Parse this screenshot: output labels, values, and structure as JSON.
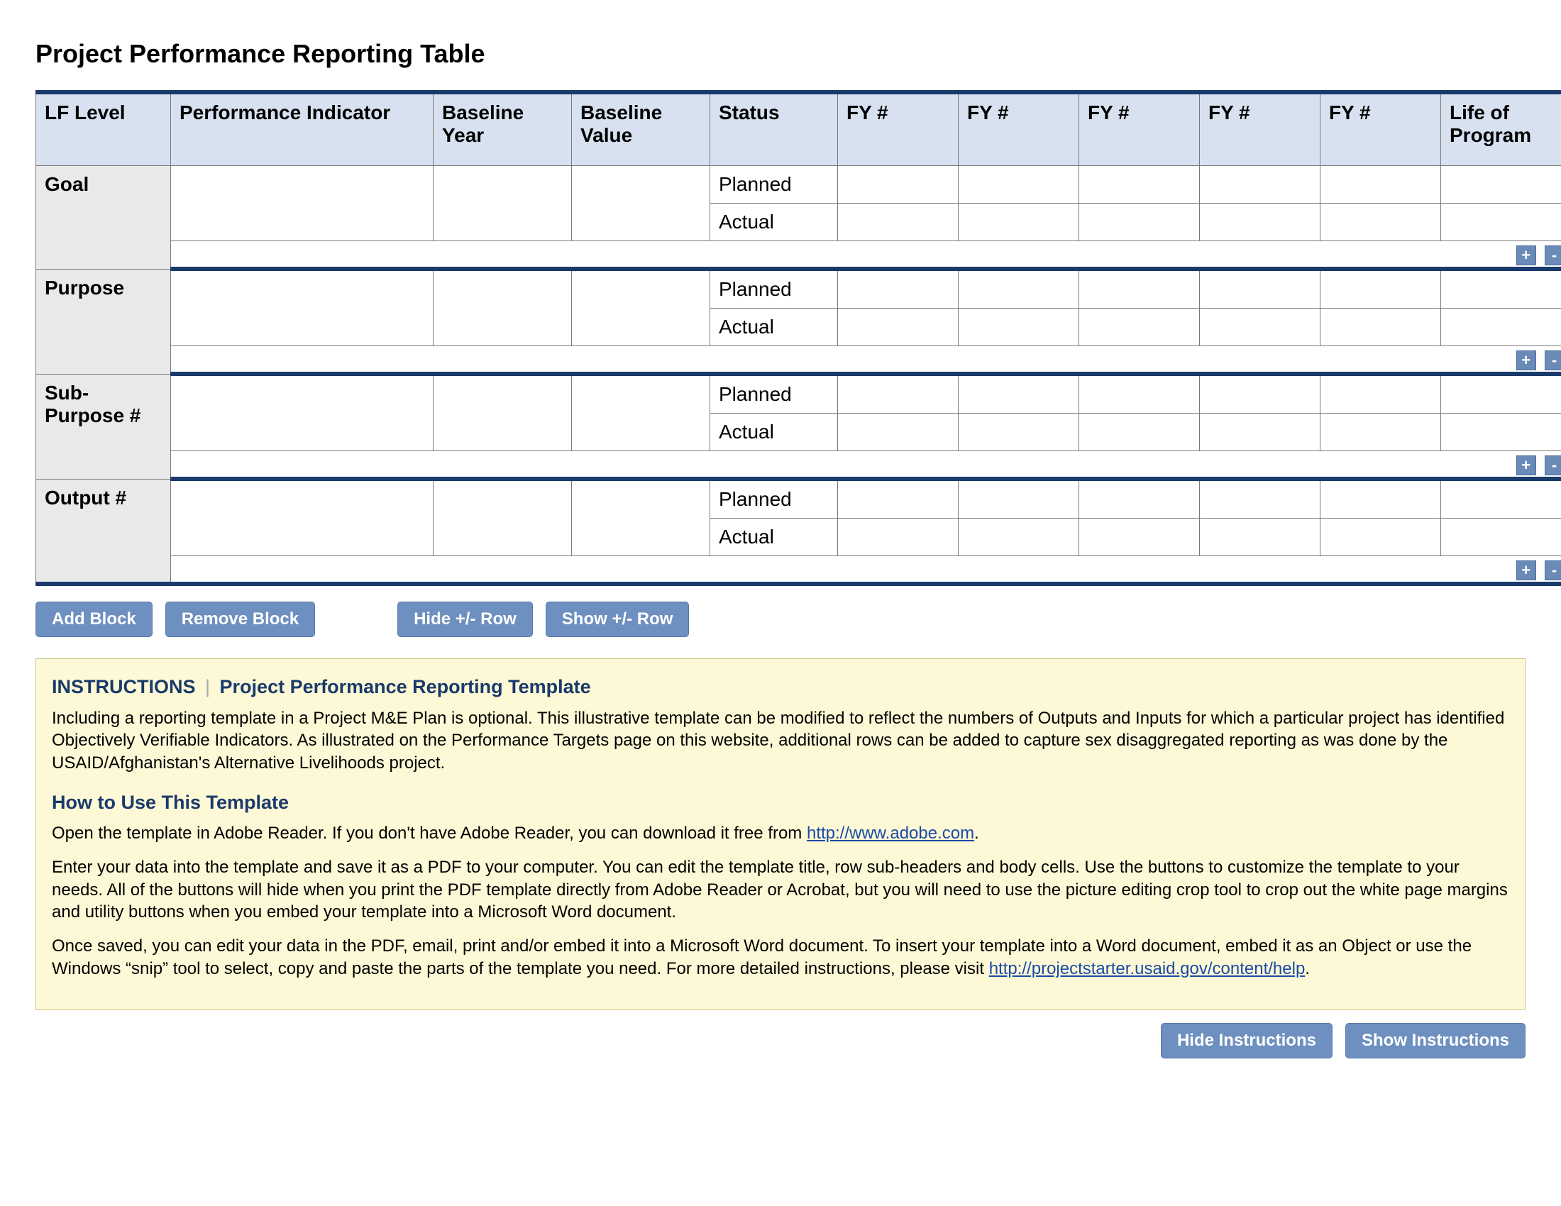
{
  "title": "Project Performance Reporting Table",
  "headers": {
    "lf_level": "LF Level",
    "perf_ind": "Performance Indicator",
    "base_year": "Baseline Year",
    "base_val": "Baseline Value",
    "status": "Status",
    "fy1": "FY #",
    "fy2": "FY #",
    "fy3": "FY #",
    "fy4": "FY #",
    "fy5": "FY #",
    "life": "Life of Program"
  },
  "status_labels": {
    "planned": "Planned",
    "actual": "Actual"
  },
  "lf_levels": {
    "goal": "Goal",
    "purpose": "Purpose",
    "sub_purpose": "Sub-Purpose #",
    "output": "Output #"
  },
  "pm": {
    "plus": "+",
    "minus": "-"
  },
  "buttons": {
    "add_block": "Add Block",
    "remove_block": "Remove Block",
    "hide_row": "Hide +/- Row",
    "show_row": "Show +/- Row",
    "hide_instr": "Hide Instructions",
    "show_instr": "Show Instructions"
  },
  "instructions": {
    "heading_label": "INSTRUCTIONS",
    "heading_sub": "Project Performance Reporting Template",
    "p1": "Including a reporting template in a Project M&E Plan is optional. This illustrative template can be modified to reflect the numbers of Outputs and Inputs for which a particular project has identified Objectively Verifiable Indicators. As illustrated on the Performance Targets page on this website, additional rows can be added to capture sex disaggregated reporting as was done by the USAID/Afghanistan's Alternative Livelihoods project.",
    "howto_heading": "How to Use This Template",
    "p2a": "Open the template in Adobe Reader. If you don't have Adobe Reader, you can download it free from ",
    "p2_link": "http://www.adobe.com",
    "p2b": ".",
    "p3": "Enter your data into the template and save it as a PDF to your computer. You can edit the template title, row sub-headers and body cells. Use the buttons to customize the template to your needs. All of the buttons will hide when you print the PDF template directly from Adobe Reader or Acrobat, but you will need to use the picture editing crop tool to crop out the white page margins and utility buttons when you embed your template into a Microsoft Word document.",
    "p4a": "Once saved, you can edit your data in the PDF, email, print and/or embed it into a Microsoft Word document. To insert your template into a Word document, embed it as an Object or use the Windows “snip” tool to select, copy and paste the parts of the template you need. For more detailed instructions, please visit ",
    "p4_link": "http://projectstarter.usaid.gov/content/help",
    "p4b": "."
  }
}
